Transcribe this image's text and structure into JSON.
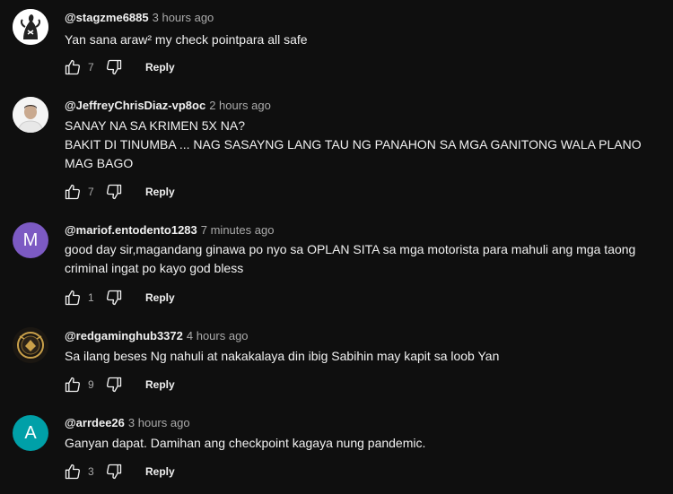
{
  "comments": [
    {
      "handle": "@stagzme6885",
      "time": "3 hours ago",
      "text": [
        "Yan sana araw² my check pointpara all safe"
      ],
      "likes": "7",
      "reply_label": "Reply",
      "avatar": {
        "type": "image",
        "icon": "dark-figure-avatar",
        "bg": "#ffffff",
        "fg": "#222222"
      }
    },
    {
      "handle": "@JeffreyChrisDiaz-vp8oc",
      "time": "2 hours ago",
      "text": [
        "SANAY NA SA KRIMEN 5X NA?",
        "BAKIT DI TINUMBA ... NAG SASAYNG LANG TAU NG PANAHON SA MGA GANITONG WALA PLANO MAG BAGO"
      ],
      "likes": "7",
      "reply_label": "Reply",
      "avatar": {
        "type": "image",
        "icon": "person-photo-avatar",
        "bg": "#f2f2f2",
        "fg": "#cfc9c4"
      }
    },
    {
      "handle": "@mariof.entodento1283",
      "time": "7 minutes ago",
      "text": [
        "good day sir,magandang ginawa po nyo sa OPLAN SITA sa mga motorista para mahuli ang mga taong criminal ingat po kayo god bless"
      ],
      "likes": "1",
      "reply_label": "Reply",
      "avatar": {
        "type": "letter",
        "letter": "M",
        "bg": "#7c5ac3"
      }
    },
    {
      "handle": "@redgaminghub3372",
      "time": "4 hours ago",
      "text": [
        "Sa ilang beses Ng nahuli at nakakalaya din ibig Sabihin may kapit sa loob Yan"
      ],
      "likes": "9",
      "reply_label": "Reply",
      "avatar": {
        "type": "image",
        "icon": "gaming-emblem-avatar",
        "bg": "#1b1712",
        "fg": "#c9a04a"
      }
    },
    {
      "handle": "@arrdee26",
      "time": "3 hours ago",
      "text": [
        "Ganyan dapat. Damihan ang checkpoint kagaya nung pandemic."
      ],
      "likes": "3",
      "reply_label": "Reply",
      "avatar": {
        "type": "letter",
        "letter": "A",
        "bg": "#00a0a8"
      }
    }
  ]
}
